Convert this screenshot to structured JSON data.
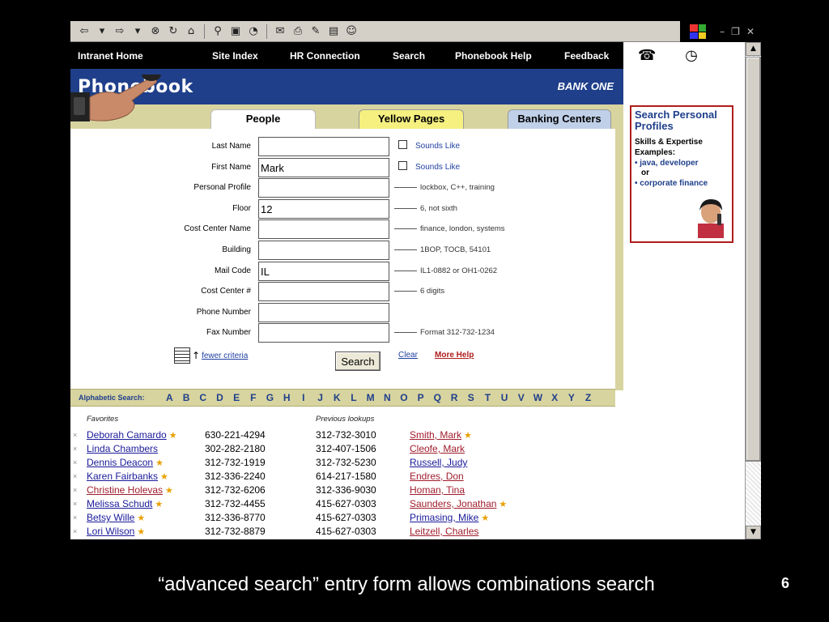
{
  "nav": {
    "items": [
      "Intranet Home",
      "Site Index",
      "HR Connection",
      "Search",
      "Phonebook Help",
      "Feedback"
    ]
  },
  "banner": {
    "title": "Phonebook",
    "logo": "BANK ONE"
  },
  "tabs": [
    "People",
    "Yellow Pages",
    "Banking Centers"
  ],
  "form": {
    "fields": [
      {
        "label": "Last Name",
        "value": "",
        "checkbox": "Sounds Like"
      },
      {
        "label": "First Name",
        "value": "Mark",
        "checkbox": "Sounds Like"
      },
      {
        "label": "Personal Profile",
        "value": "",
        "hint": "lockbox, C++, training"
      },
      {
        "label": "Floor",
        "value": "12",
        "hint": "6, not sixth"
      },
      {
        "label": "Cost Center Name",
        "value": "",
        "hint": "finance, london, systems"
      },
      {
        "label": "Building",
        "value": "",
        "hint": "1BOP, TOCB, 54101"
      },
      {
        "label": "Mail Code",
        "value": "IL",
        "hint": "IL1-0882 or OH1-0262"
      },
      {
        "label": "Cost Center #",
        "value": "",
        "hint": "6 digits"
      },
      {
        "label": "Phone Number",
        "value": "",
        "hint": ""
      },
      {
        "label": "Fax Number",
        "value": "",
        "hint": "Format 312-732-1234"
      }
    ],
    "fewer_criteria": "fewer criteria",
    "search_label": "Search",
    "clear_label": "Clear",
    "more_help_label": "More Help"
  },
  "alpha": {
    "label": "Alphabetic Search:",
    "letters": [
      "A",
      "B",
      "C",
      "D",
      "E",
      "F",
      "G",
      "H",
      "I",
      "J",
      "K",
      "L",
      "M",
      "N",
      "O",
      "P",
      "Q",
      "R",
      "S",
      "T",
      "U",
      "V",
      "W",
      "X",
      "Y",
      "Z"
    ]
  },
  "favorites": {
    "heading": "Favorites",
    "rows": [
      {
        "name": "Deborah Camardo",
        "phone": "630-221-4294",
        "star": true,
        "color": "#1a1a9a"
      },
      {
        "name": "Linda Chambers",
        "phone": "302-282-2180",
        "star": false,
        "color": "#1a1a9a"
      },
      {
        "name": "Dennis Deacon",
        "phone": "312-732-1919",
        "star": true,
        "color": "#1a1a9a"
      },
      {
        "name": "Karen Fairbanks",
        "phone": "312-336-2240",
        "star": true,
        "color": "#1a1a9a"
      },
      {
        "name": "Christine Holevas",
        "phone": "312-732-6206",
        "star": true,
        "color": "#a01c2c"
      },
      {
        "name": "Melissa Schudt",
        "phone": "312-732-4455",
        "star": true,
        "color": "#1a1a9a"
      },
      {
        "name": "Betsy Wille",
        "phone": "312-336-8770",
        "star": true,
        "color": "#1a1a9a"
      },
      {
        "name": "Lori Wilson",
        "phone": "312-732-8879",
        "star": true,
        "color": "#1a1a9a"
      }
    ]
  },
  "previous": {
    "heading": "Previous lookups",
    "rows": [
      {
        "phone": "312-732-3010",
        "name": "Smith, Mark",
        "star": true
      },
      {
        "phone": "312-407-1506",
        "name": "Cleofe, Mark",
        "star": false
      },
      {
        "phone": "312-732-5230",
        "name": "Russell, Judy",
        "star": false
      },
      {
        "phone": "614-217-1580",
        "name": "Endres, Don",
        "star": false
      },
      {
        "phone": "312-336-9030",
        "name": "Homan, Tina",
        "star": false
      },
      {
        "phone": "415-627-0303",
        "name": "Saunders, Jonathan",
        "star": true
      },
      {
        "phone": "415-627-0303",
        "name": "Primasing, Mike",
        "star": true
      },
      {
        "phone": "415-627-0303",
        "name": "Leitzell, Charles",
        "star": false
      }
    ],
    "colors": [
      "#a01c2c",
      "#a01c2c",
      "#1a1a9a",
      "#a01c2c",
      "#a01c2c",
      "#a01c2c",
      "#1a1a9a",
      "#a01c2c"
    ]
  },
  "promo": {
    "title": "Search Personal Profiles",
    "subtitle": "Skills & Expertise Examples:",
    "example1": "java, developer",
    "or": "or",
    "example2": "corporate finance"
  },
  "caption": "“advanced search” entry form allows combinations search",
  "slide_number": "6",
  "colors": {
    "nav_bg": "#000000",
    "banner": "#1f3f8a",
    "tabbar": "#d8d4a0",
    "link": "#1a1a9a",
    "visited": "#a01c2c",
    "star": "#e8a000"
  }
}
